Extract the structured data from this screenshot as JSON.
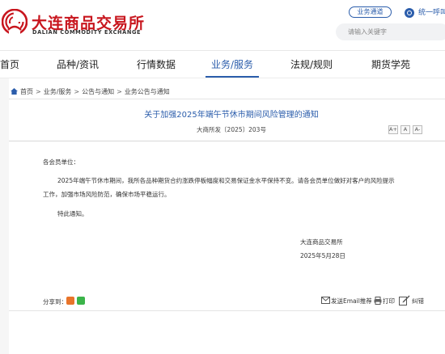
{
  "header": {
    "logo_cn": "大连商品交易所",
    "logo_en": "DALIAN COMMODITY EXCHANGE",
    "biz_channel": "业务通道",
    "unified_login": "统一呼叫",
    "search_placeholder": "请输入关键字"
  },
  "nav": {
    "items": [
      "首页",
      "品种/资讯",
      "行情数据",
      "业务/服务",
      "法规/规则",
      "期货学苑"
    ],
    "active_index": 3
  },
  "breadcrumb": [
    "首页",
    "业务/服务",
    "公告与通知",
    "业务公告与通知"
  ],
  "article": {
    "title": "关于加强2025年端午节休市期间风险管理的通知",
    "doc_number": "大商所发〔2025〕203号",
    "font_buttons": [
      "A+",
      "A",
      "A-"
    ],
    "salutation": "各会员单位：",
    "paragraph_line1": "2025年端午节休市期间，我所各品种期货合约涨跌停板幅度和交易保证金水平保持不变。请各会员单位做好对客户的风险提示",
    "paragraph_line2": "工作，加强市场风险防范，确保市场平稳运行。",
    "closing": "特此通知。",
    "signer": "大连商品交易所",
    "date": "2025年5月28日"
  },
  "footer": {
    "share_label": "分享到：",
    "email_label": "发送Email推荐",
    "print_label": "打印",
    "error_label": "纠错"
  },
  "colors": {
    "brand_red": "#c8161e",
    "accent_blue": "#2b5dab"
  }
}
